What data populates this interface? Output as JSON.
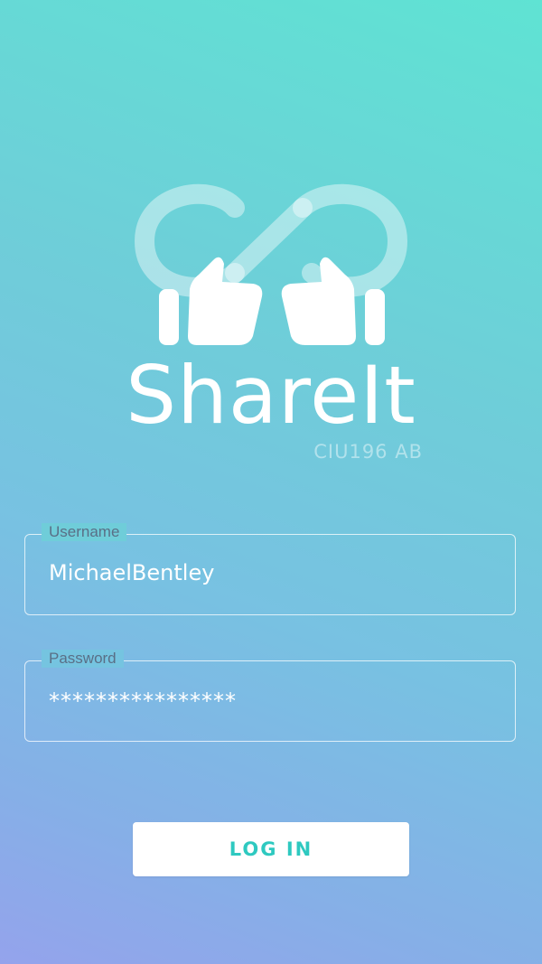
{
  "app": {
    "title": "ShareIt",
    "subtitle": "CIU196 AB",
    "logo_icon": "infinity-thumbs-up-logo"
  },
  "form": {
    "username": {
      "label": "Username",
      "value": "MichaelBentley"
    },
    "password": {
      "label": "Password",
      "value": "****************"
    },
    "login_label": "LOG IN"
  },
  "colors": {
    "gradient_top": "#5fe3d3",
    "gradient_bottom": "#94a3ec",
    "button_text": "#2ec9c0",
    "button_bg": "#ffffff"
  }
}
